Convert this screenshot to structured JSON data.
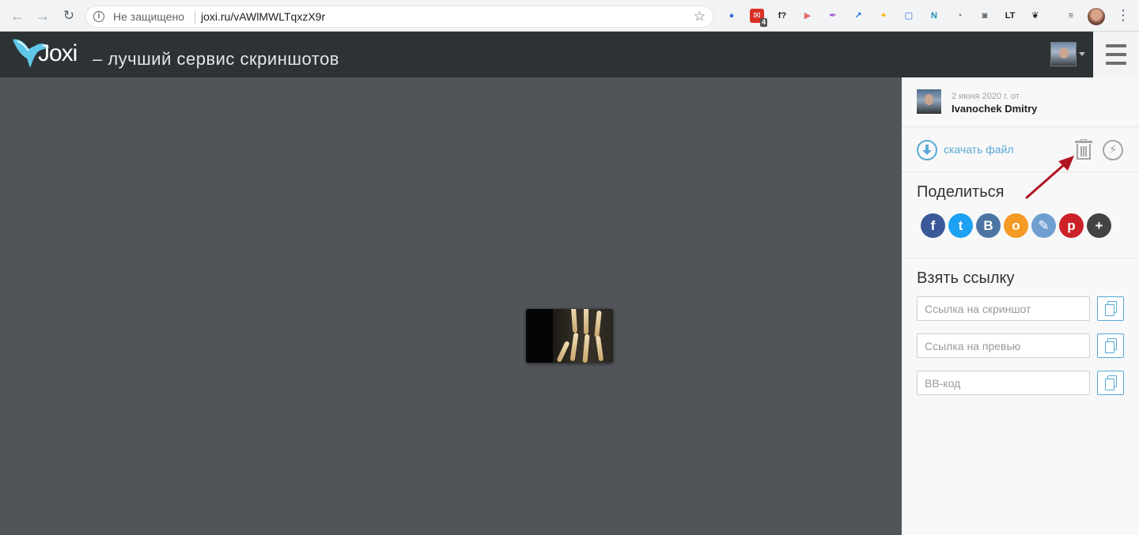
{
  "browser": {
    "not_secure": "Не защищено",
    "url": "joxi.ru/vAWlMWLTqxzX9r",
    "extension_badge": "4",
    "extensions": [
      {
        "name": "color-wheel-icon",
        "color": "#3a6fd8"
      },
      {
        "name": "mail-icon",
        "color": "#d93025"
      },
      {
        "name": "font-icon",
        "color": "#202124"
      },
      {
        "name": "play-icon",
        "color": "#e66b6b"
      },
      {
        "name": "feather-icon",
        "color": "#9b4fd1"
      },
      {
        "name": "arrow-square-icon",
        "color": "#1a73e8"
      },
      {
        "name": "flame-icon",
        "color": "#f2b705"
      },
      {
        "name": "crop-icon",
        "color": "#1a73e8"
      },
      {
        "name": "n-bracket-icon",
        "color": "#1a8fb5"
      },
      {
        "name": "speedometer-icon",
        "color": "#5f6368"
      },
      {
        "name": "camera-icon",
        "color": "#5f6368"
      },
      {
        "name": "lt-icon",
        "color": "#202124"
      },
      {
        "name": "leaf-icon",
        "color": "#202124"
      },
      {
        "name": "playlist-icon",
        "color": "#5f6368"
      }
    ]
  },
  "header": {
    "logo": "Joxi",
    "tagline": "– лучший сервис скриншотов"
  },
  "sidebar": {
    "upload_date": "2 июня 2020 г. от",
    "user_name": "Ivanochek Dmitry",
    "download_label": "скачать файл",
    "share_title": "Поделиться",
    "share_buttons": [
      {
        "name": "facebook-share-button",
        "glyph": "f",
        "color": "#3b5998"
      },
      {
        "name": "twitter-share-button",
        "glyph": "t",
        "color": "#1da1f2"
      },
      {
        "name": "vk-share-button",
        "glyph": "B",
        "color": "#4c75a3"
      },
      {
        "name": "odnoklassniki-share-button",
        "glyph": "о",
        "color": "#f59a23"
      },
      {
        "name": "livejournal-share-button",
        "glyph": "✎",
        "color": "#6f9fcf"
      },
      {
        "name": "pinterest-share-button",
        "glyph": "p",
        "color": "#cb2027"
      },
      {
        "name": "more-share-button",
        "glyph": "+",
        "color": "#444444"
      }
    ],
    "link_title": "Взять ссылку",
    "link_fields": [
      {
        "placeholder": "Ссылка на скриншот"
      },
      {
        "placeholder": "Ссылка на превью"
      },
      {
        "placeholder": "ВВ-код"
      }
    ]
  },
  "colors": {
    "accent": "#5aa9d6",
    "annotation_arrow": "#b01622"
  }
}
